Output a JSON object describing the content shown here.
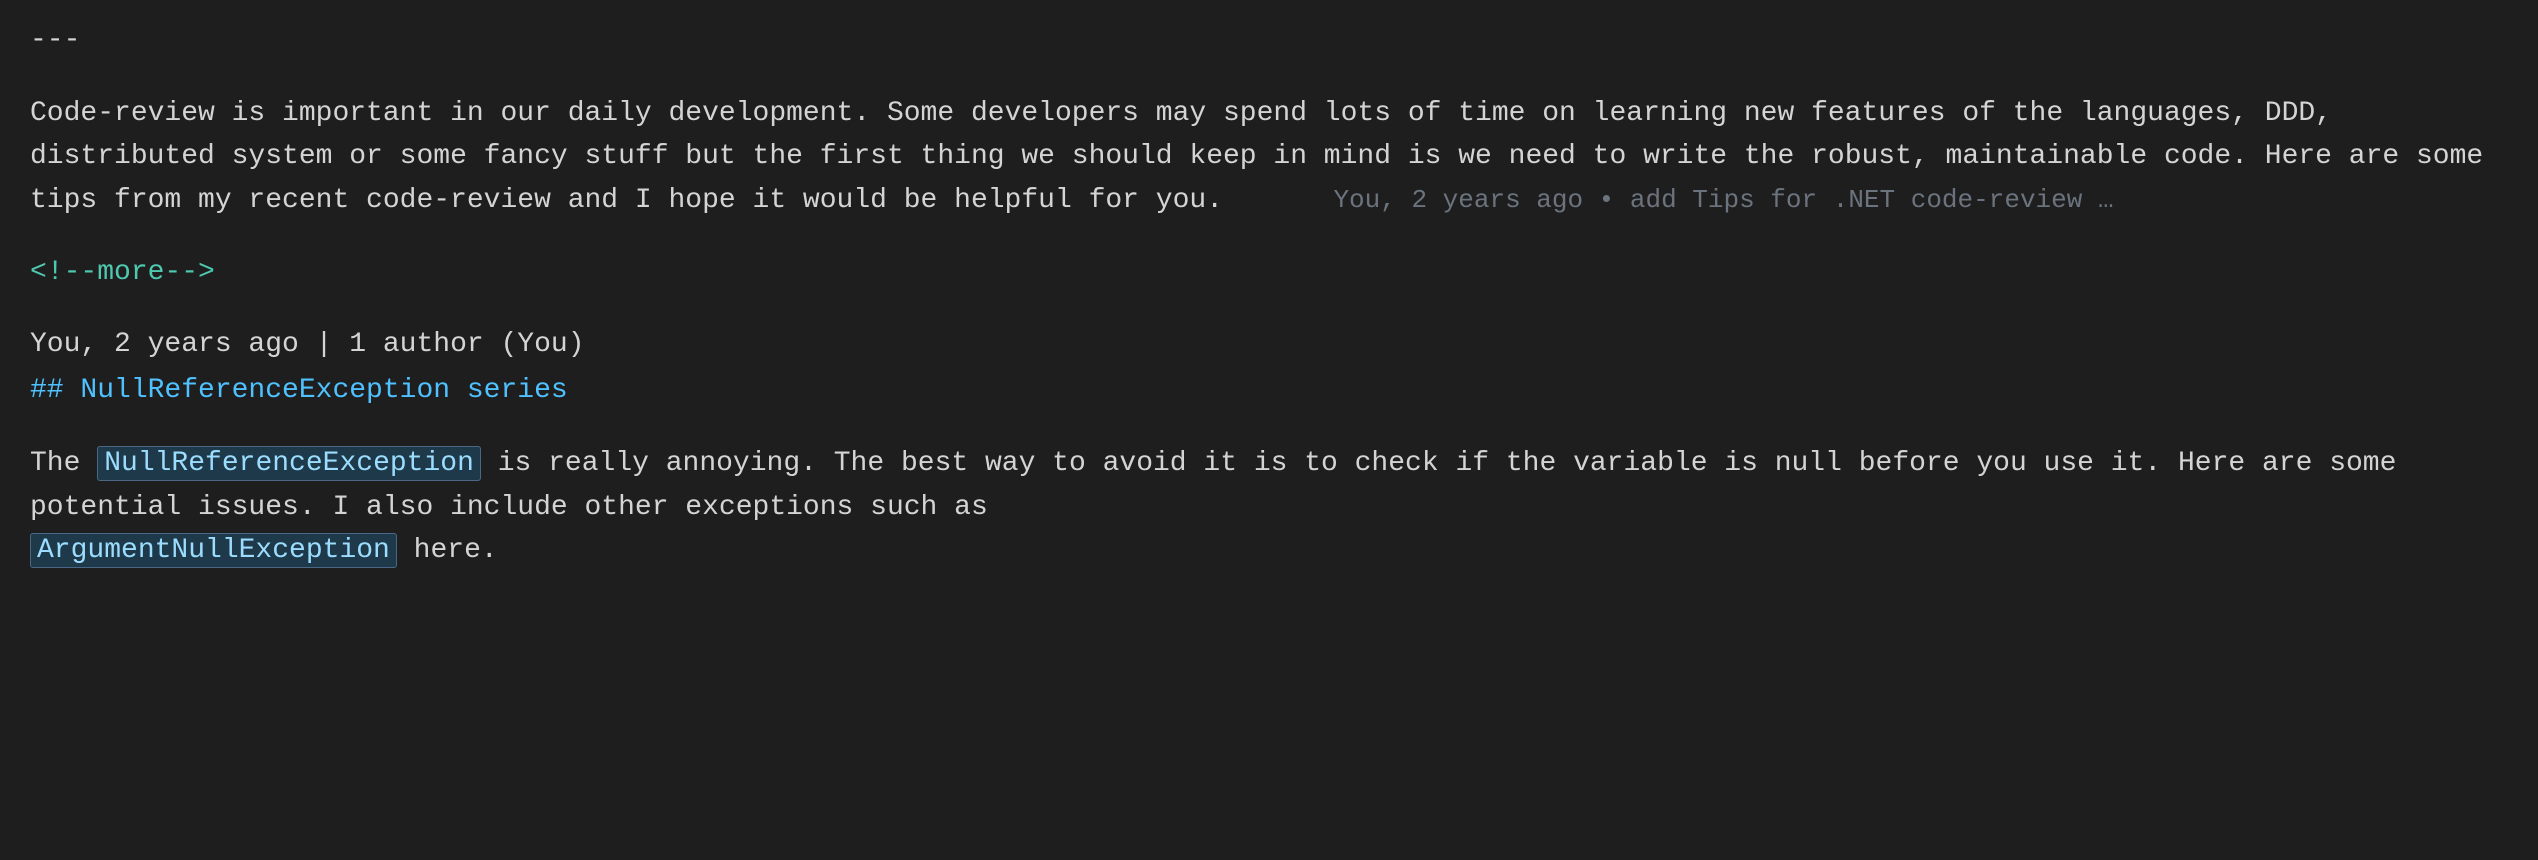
{
  "separator": "---",
  "paragraph1": {
    "text": "Code-review is important in our daily development. Some developers may spend lots of time on learning new features of the languages, DDD, distributed system or some fancy stuff but the first thing we should keep in mind is we need to write the robust, maintainable code. Here are some tips from my recent code-review and I hope it would be helpful for you.",
    "git_info": "You, 2 years ago • add Tips for .NET code-review …"
  },
  "comment_tag": "<!--more-->",
  "file_meta": "You, 2 years ago | 1 author (You)",
  "heading": "## NullReferenceException series",
  "paragraph2": {
    "before_code1": "The ",
    "code1": "NullReferenceException",
    "after_code1": " is really annoying. The best way to avoid it is to check if the variable is null before you use it. Here are some potential issues. I also include other exceptions such as",
    "code2": "ArgumentNullException",
    "after_code2": " here."
  }
}
